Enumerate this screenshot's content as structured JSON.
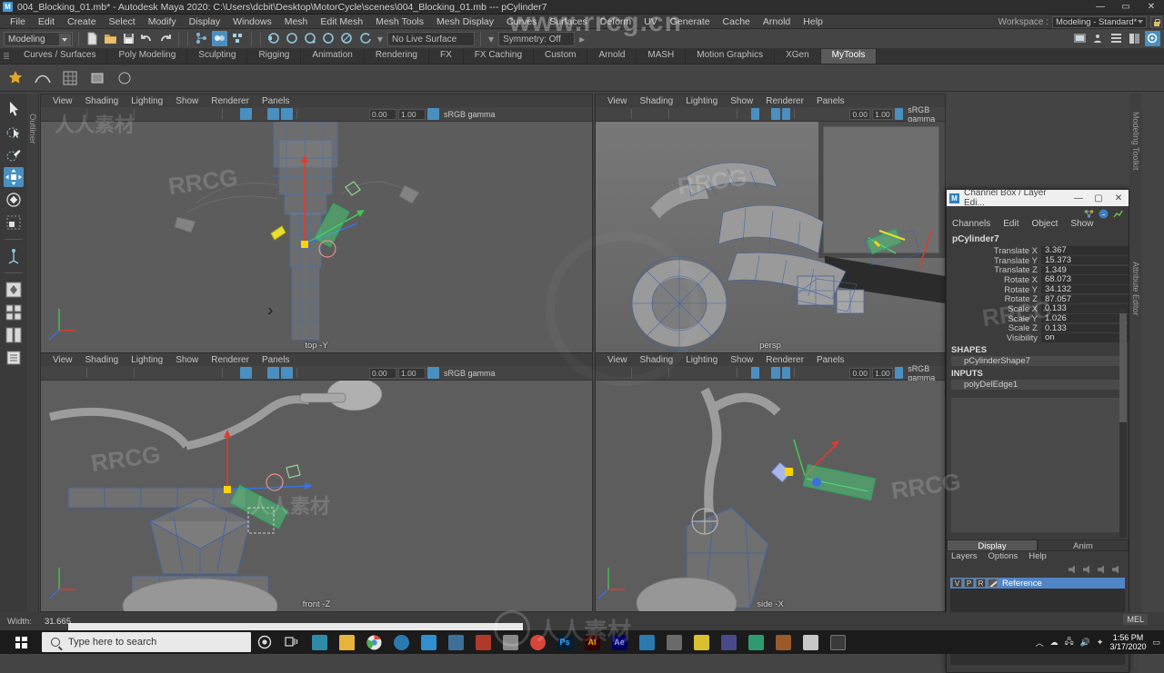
{
  "titlebar": {
    "app_icon": "maya-icon",
    "text": "004_Blocking_01.mb* - Autodesk Maya 2020: C:\\Users\\dcbit\\Desktop\\MotorCycle\\scenes\\004_Blocking_01.mb   ---   pCylinder7",
    "minimize": "—",
    "maximize": "▭",
    "close": "✕"
  },
  "menubar": {
    "items": [
      "File",
      "Edit",
      "Create",
      "Select",
      "Modify",
      "Display",
      "Windows",
      "Mesh",
      "Edit Mesh",
      "Mesh Tools",
      "Mesh Display",
      "Curves",
      "Surfaces",
      "Deform",
      "UV",
      "Generate",
      "Cache",
      "Arnold",
      "Help"
    ],
    "workspace_label": "Workspace :",
    "workspace_value": "Modeling - Standard*"
  },
  "statusline": {
    "menuset": "Modeling",
    "live_surface": "No Live Surface",
    "symmetry": "Symmetry: Off"
  },
  "shelf": {
    "tabs": [
      "Curves / Surfaces",
      "Poly Modeling",
      "Sculpting",
      "Rigging",
      "Animation",
      "Rendering",
      "FX",
      "FX Caching",
      "Custom",
      "Arnold",
      "MASH",
      "Motion Graphics",
      "XGen",
      "MyTools"
    ],
    "active_tab": "MyTools"
  },
  "toolbox": {
    "items": [
      {
        "name": "select-tool",
        "active": false
      },
      {
        "name": "lasso-select-tool",
        "active": false
      },
      {
        "name": "paint-select-tool",
        "active": false
      },
      {
        "name": "move-tool",
        "active": true
      },
      {
        "name": "rotate-tool",
        "active": false
      },
      {
        "name": "scale-tool",
        "active": false
      },
      {
        "name": "last-tool",
        "active": false
      }
    ]
  },
  "outliner_tab": "Outliner",
  "right_tabs": [
    "Modeling Toolkit",
    "Attribute Editor"
  ],
  "viewport_menus": [
    "View",
    "Shading",
    "Lighting",
    "Show",
    "Renderer",
    "Panels"
  ],
  "viewport_toolbar": {
    "exposure": "0.00",
    "gamma": "1.00",
    "color_space": "sRGB gamma"
  },
  "viewports": [
    {
      "id": "vp-top",
      "label": "top -Y"
    },
    {
      "id": "vp-persp",
      "label": "persp"
    },
    {
      "id": "vp-front",
      "label": "front -Z"
    },
    {
      "id": "vp-side",
      "label": "side -X"
    }
  ],
  "channelbox": {
    "window_title": "Channel Box / Layer Edi...",
    "minimize": "—",
    "maximize": "▢",
    "close": "✕",
    "menus": [
      "Channels",
      "Edit",
      "Object",
      "Show"
    ],
    "object_name": "pCylinder7",
    "attributes": [
      {
        "label": "Translate X",
        "value": "3.367"
      },
      {
        "label": "Translate Y",
        "value": "15.373"
      },
      {
        "label": "Translate Z",
        "value": "1.349"
      },
      {
        "label": "Rotate X",
        "value": "68.073"
      },
      {
        "label": "Rotate Y",
        "value": "34.132"
      },
      {
        "label": "Rotate Z",
        "value": "87.057"
      },
      {
        "label": "Scale X",
        "value": "0.133"
      },
      {
        "label": "Scale Y",
        "value": "1.026"
      },
      {
        "label": "Scale Z",
        "value": "0.133"
      },
      {
        "label": "Visibility",
        "value": "on"
      }
    ],
    "shapes_header": "SHAPES",
    "shapes_item": "pCylinderShape7",
    "inputs_header": "INPUTS",
    "inputs_item": "polyDelEdge1"
  },
  "layereditor": {
    "tabs": [
      "Display",
      "Anim"
    ],
    "active_tab": "Display",
    "menus": [
      "Layers",
      "Options",
      "Help"
    ],
    "layers": [
      {
        "v": "V",
        "p": "P",
        "r": "R",
        "name": "Reference"
      }
    ]
  },
  "helpline": {
    "label": "Width:",
    "value": "31.665",
    "script_lang": "MEL"
  },
  "taskbar": {
    "search_placeholder": "Type here to search",
    "clock_time": "1:56 PM",
    "clock_date": "3/17/2020"
  },
  "watermarks": {
    "url": "www.rrcg.cn",
    "brand": "RRCG",
    "cn": "人人素材"
  },
  "colors": {
    "accent": "#4a8fc0",
    "layer_selected": "#5285c6",
    "window_bg": "#444444",
    "panel_bg": "#3c3c3c",
    "viewport_bg": "#5a5a5a"
  }
}
